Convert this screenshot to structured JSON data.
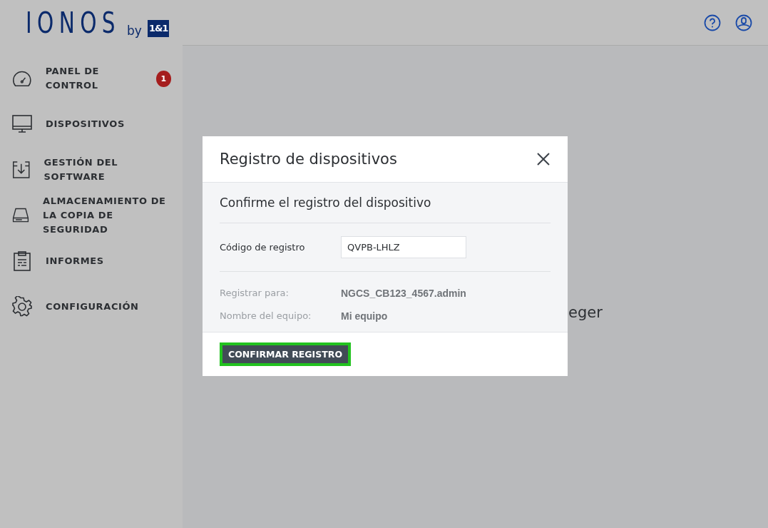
{
  "logo": {
    "wordmark": "IONOS",
    "by": "by",
    "partner": "1&1"
  },
  "sidebar": {
    "items": [
      {
        "label": "PANEL DE CONTROL",
        "badge": "1"
      },
      {
        "label": "DISPOSITIVOS"
      },
      {
        "label": "GESTIÓN DEL SOFTWARE"
      },
      {
        "label": "ALMACENAMIENTO DE LA COPIA DE SEGURIDAD"
      },
      {
        "label": "INFORMES"
      },
      {
        "label": "CONFIGURACIÓN"
      }
    ]
  },
  "background_text": "eger",
  "dialog": {
    "title": "Registro de dispositivos",
    "subtitle": "Confirme el registro del dispositivo",
    "code_label": "Código de registro",
    "code_value": "QVPB-LHLZ",
    "details": [
      {
        "label": "Registrar para:",
        "value": "NGCS_CB123_4567.admin"
      },
      {
        "label": "Nombre del equipo:",
        "value": "Mi equipo"
      }
    ],
    "confirm_button": "CONFIRMAR REGISTRO",
    "highlighted": true
  }
}
